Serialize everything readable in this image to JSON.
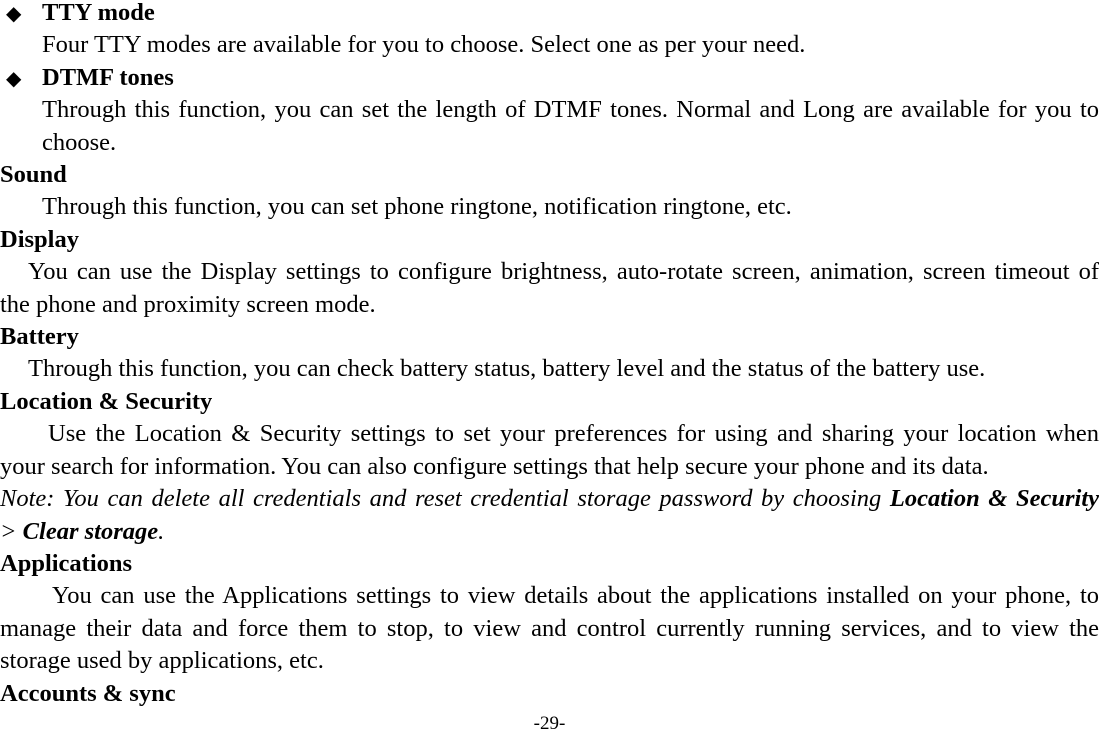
{
  "document": {
    "page_number_label": "-29-",
    "bullet_glyph": "◆",
    "bullet_glyph_name": "diamond-bullet-icon",
    "text_color": "#000000",
    "background_color": "#ffffff"
  },
  "sections": [
    {
      "type": "bullet",
      "title": "TTY mode",
      "body": "Four TTY modes are available for you to choose. Select one as per your need.",
      "body_lines": [
        "Four TTY modes are available for you to choose. Select one as per your need."
      ]
    },
    {
      "type": "bullet",
      "title": "DTMF tones",
      "body": "Through this function, you can set the length of DTMF tones. Normal and Long are available for you to choose.",
      "body_lines": [
        "Through this function, you can set the length of DTMF tones. Normal and Long are available for you to",
        "choose."
      ]
    },
    {
      "type": "heading",
      "title": "Sound",
      "body": "Through this function, you can set phone ringtone, notification ringtone, etc.",
      "body_lines": [
        "Through this function, you can set phone ringtone, notification ringtone, etc."
      ],
      "indent": 42
    },
    {
      "type": "heading",
      "title": "Display",
      "body": "You can use the Display settings to configure brightness, auto-rotate screen, animation, screen timeout of the phone and proximity screen mode.",
      "body_lines": [
        "You can use the Display settings to configure brightness, auto-rotate screen, animation, screen timeout of",
        "the phone and proximity screen mode."
      ],
      "indent": 28
    },
    {
      "type": "heading",
      "title": "Battery",
      "body": "Through this function, you can check battery status, battery level and the status of the battery use.",
      "body_lines": [
        "Through this function, you can check battery status, battery level and the status of the battery use."
      ],
      "indent": 28
    },
    {
      "type": "heading",
      "title": "Location & Security",
      "body": "Use the Location & Security settings to set your preferences for using and sharing your location when your search for information. You can also configure settings that help secure your phone and its data.",
      "body_lines": [
        "Use the Location & Security settings to set your preferences for using and sharing your location when",
        "your search for information. You can also configure settings that help secure your phone and its data."
      ],
      "indent": 48
    },
    {
      "type": "note",
      "note_prefix": "Note: You can delete all credentials and reset credential storage password by choosing ",
      "note_emphasis_1": "Location & Security",
      "note_middle": "> ",
      "note_emphasis_2": "Clear storage",
      "note_suffix": "."
    },
    {
      "type": "heading",
      "title": "Applications",
      "body": "You can use the Applications settings to view details about the applications installed on your phone, to manage their data and force them to stop, to view and control currently running services, and to view the storage used by applications, etc.",
      "body_lines": [
        "You can use the Applications settings to view details about the applications installed on your phone, to",
        "manage their data and force them to stop, to view and control currently running services, and to view the",
        "storage used by applications, etc."
      ],
      "indent": 52
    },
    {
      "type": "heading",
      "title": "Accounts & sync",
      "body": "",
      "body_lines": []
    }
  ]
}
